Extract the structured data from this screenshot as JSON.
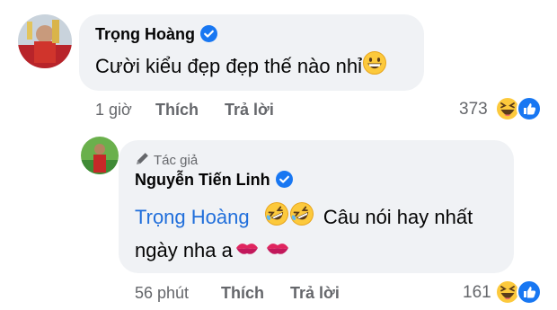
{
  "comment1": {
    "author": "Trọng Hoàng",
    "text": "Cười kiểu đẹp đẹp thế nào nhỉ",
    "time": "1 giờ",
    "like_label": "Thích",
    "reply_label": "Trả lời",
    "reaction_count": "373"
  },
  "reply1": {
    "author_badge": "Tác giả",
    "author": "Nguyễn Tiến Linh",
    "mention": "Trọng Hoàng",
    "text_line1": "Câu nói hay nhất",
    "text_line2": "ngày nha a",
    "time": "56 phút",
    "like_label": "Thích",
    "reply_label": "Trả lời",
    "reaction_count": "161"
  },
  "colors": {
    "bubble": "#f0f2f5",
    "verified": "#1877f2",
    "mention": "#216fdb",
    "meta": "#65676b"
  }
}
